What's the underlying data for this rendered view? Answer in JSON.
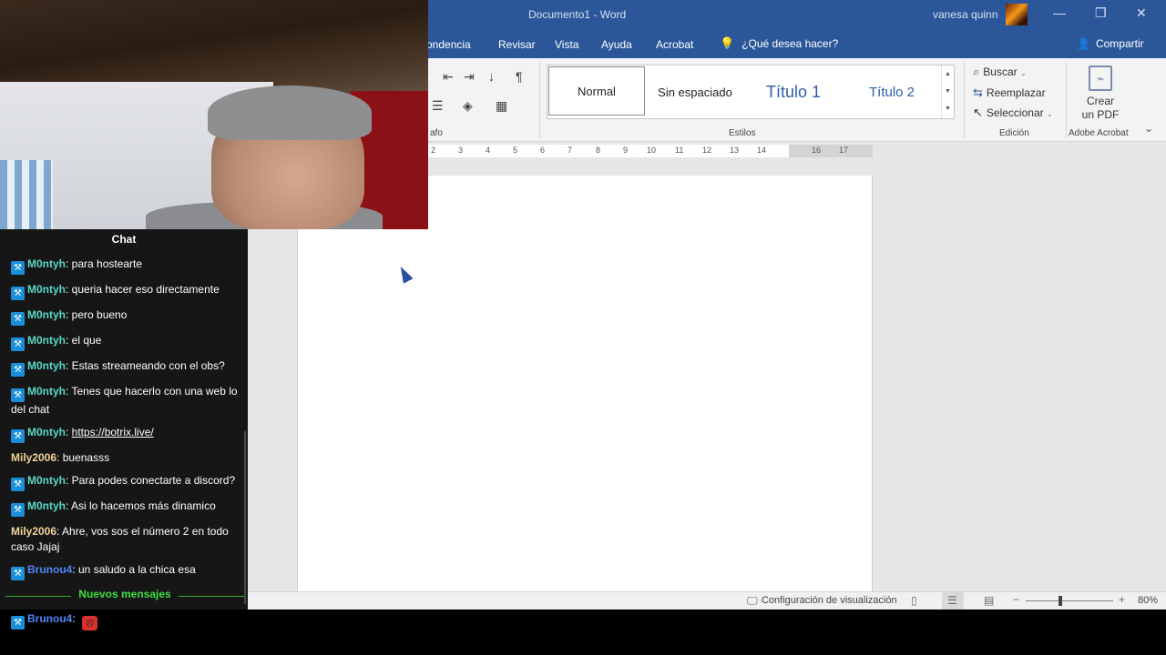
{
  "window": {
    "title": "Documento1  -  Word",
    "user": "vanesa quinn",
    "min_glyph": "—",
    "restore_glyph": "❐",
    "close_glyph": "✕"
  },
  "ribbon_tabs": {
    "correspondencia": "ondencia",
    "revisar": "Revisar",
    "vista": "Vista",
    "ayuda": "Ayuda",
    "acrobat": "Acrobat",
    "tell_me": "¿Qué desea hacer?",
    "share": "Compartir"
  },
  "ribbon": {
    "paragraph_label": "afo",
    "styles": [
      "Normal",
      "Sin espaciado",
      "Título 1",
      "Título 2"
    ],
    "styles_label": "Estilos",
    "edit": {
      "find": "Buscar",
      "replace": "Reemplazar",
      "select": "Seleccionar",
      "label": "Edición"
    },
    "pdf": {
      "line1": "Crear",
      "line2": "un PDF",
      "label": "Adobe Acrobat"
    }
  },
  "ruler": {
    "ticks": [
      "2",
      "3",
      "4",
      "5",
      "6",
      "7",
      "8",
      "9",
      "10",
      "11",
      "12",
      "13",
      "14",
      "16",
      "17"
    ]
  },
  "statusbar": {
    "display_settings": "Configuración de visualización",
    "zoom_minus": "−",
    "zoom_plus": "+",
    "zoom": "80%"
  },
  "chat": {
    "title": "Chat",
    "new_messages": "Nuevos mensajes",
    "messages": [
      {
        "user": "M0ntyh",
        "text": ": para hostearte"
      },
      {
        "user": "M0ntyh",
        "text": ": queria hacer eso directamente"
      },
      {
        "user": "M0ntyh",
        "text": ": pero bueno"
      },
      {
        "user": "M0ntyh",
        "text": ": el que"
      },
      {
        "user": "M0ntyh",
        "text": ": Estas streameando con el obs?"
      },
      {
        "user": "M0ntyh",
        "text": ": Tenes que hacerlo con una web lo del chat"
      },
      {
        "user": "M0ntyh",
        "text": ": ",
        "link": "https://botrix.live/"
      },
      {
        "user": "Mily2006",
        "text": ": buenasss"
      },
      {
        "user": "M0ntyh",
        "text": ": Para podes conectarte a discord?"
      },
      {
        "user": "M0ntyh",
        "text": ": Asi lo hacemos más dinamico"
      },
      {
        "user": "Mily2006",
        "text": ": Ahre, vos sos el número 2 en todo caso Jajaj"
      },
      {
        "user": "Brunou4",
        "text": ": un saludo a la chica esa"
      },
      {
        "user": "Brunou4",
        "text": ": "
      }
    ]
  },
  "colors": {
    "word_blue": "#2b579a",
    "monty": "#59d8c6",
    "mily": "#f2d29a",
    "bruno": "#4f86f7",
    "new_messages": "#3fdd3f"
  }
}
